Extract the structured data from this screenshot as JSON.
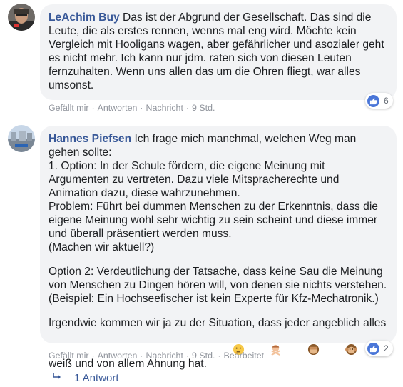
{
  "comments": [
    {
      "author": "LeAchim Buy",
      "text": " Das ist der Abgrund der Gesellschaft. Das sind die\nLeute, die als erstes rennen, wenns mal eng wird. Möchte kein\nVergleich mit Hooligans wagen, aber gefährlicher und asozialer geht\nes nicht mehr. Ich kann nur jdm. raten sich von diesen Leuten\nfernzuhalten. Wenn uns allen das um die Ohren fliegt, war alles\numsonst.",
      "reaction_count": "6",
      "actions": {
        "like": "Gefällt mir",
        "reply": "Antworten",
        "message": "Nachricht",
        "time": "9 Std."
      }
    },
    {
      "author": "Hannes Piefsen",
      "intro": " Ich frage mich manchmal, welchen Weg man\ngehen sollte:",
      "para1": "1. Option: In der Schule fördern, die eigene Meinung mit\nArgumenten zu vertreten. Dazu viele Mitspracherechte und\nAnimation dazu, diese wahrzunehmen.\nProblem: Führt bei dummen Menschen zu der Erkenntnis, dass die\neigene Meinung wohl sehr wichtig zu sein scheint und diese immer\nund überall präsentiert werden muss.\n(Machen wir aktuell?)",
      "para2": "Option 2: Verdeutlichung der Tatsache, dass keine Sau die Meinung\nvon Menschen zu Dingen hören will, von denen sie nichts verstehen.\n(Beispiel: Ein Hochseefischer ist kein Experte für Kfz-Mechatronik.)",
      "para3": "Irgendwie kommen wir ja zu der Situation, dass jeder angeblich alles\nweiß und von allem Ahnung hat.",
      "emojis": [
        "thinking-face",
        "woman-gesturing-no",
        "see-no-evil-monkey",
        "hear-no-evil-monkey"
      ],
      "reaction_count": "2",
      "actions": {
        "like": "Gefällt mir",
        "reply": "Antworten",
        "message": "Nachricht",
        "time": "9 Std.",
        "edited": "Bearbeitet"
      }
    }
  ],
  "replies_link": "1 Antwort",
  "colors": {
    "author": "#385898",
    "bubble": "#f2f3f5",
    "meta": "#90949c",
    "like": "#4a76d8"
  }
}
